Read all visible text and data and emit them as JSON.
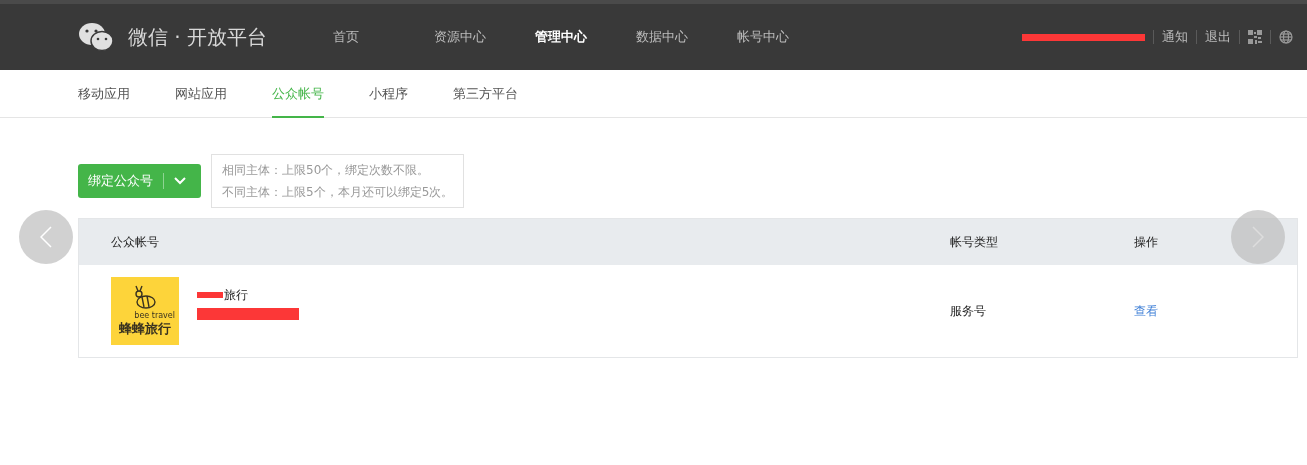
{
  "header": {
    "logo_text": "微信 · 开放平台",
    "nav": [
      {
        "label": "首页",
        "selected": false
      },
      {
        "label": "资源中心",
        "selected": false
      },
      {
        "label": "管理中心",
        "selected": true
      },
      {
        "label": "数据中心",
        "selected": false
      },
      {
        "label": "帐号中心",
        "selected": false
      }
    ],
    "links": [
      "通知",
      "退出"
    ]
  },
  "subnav": [
    {
      "label": "移动应用",
      "selected": false
    },
    {
      "label": "网站应用",
      "selected": false
    },
    {
      "label": "公众帐号",
      "selected": true
    },
    {
      "label": "小程序",
      "selected": false
    },
    {
      "label": "第三方平台",
      "selected": false
    }
  ],
  "bind_button": {
    "label": "绑定公众号"
  },
  "tip": [
    "相同主体：上限50个，绑定次数不限。",
    "不同主体：上限5个，本月还可以绑定5次。"
  ],
  "table": {
    "columns": [
      "公众帐号",
      "帐号类型",
      "操作"
    ],
    "rows": [
      {
        "logo_text": "bee travel",
        "logo_title": "蜂蜂旅行",
        "name": "旅行",
        "type": "服务号",
        "action": "查看"
      }
    ]
  }
}
